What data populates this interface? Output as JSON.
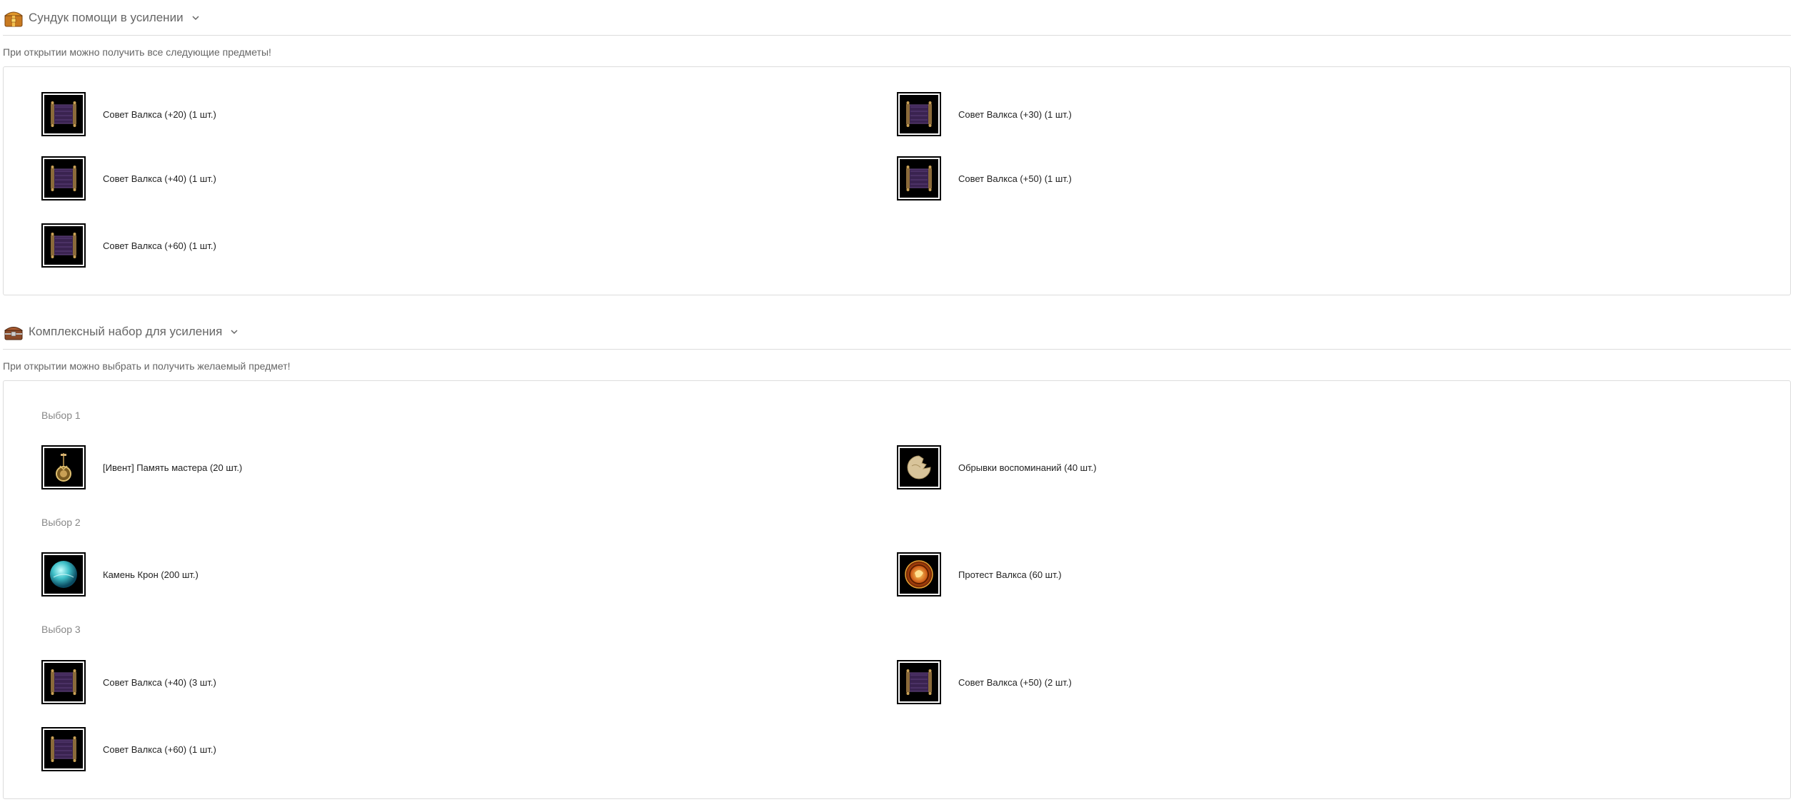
{
  "section1": {
    "title": "Сундук помощи в усилении",
    "description": "При открытии можно получить все следующие предметы!",
    "items": [
      {
        "label": "Совет Валкса (+20) (1 шт.)",
        "icon": "scroll-icon"
      },
      {
        "label": "Совет Валкса (+30) (1 шт.)",
        "icon": "scroll-icon"
      },
      {
        "label": "Совет Валкса (+40) (1 шт.)",
        "icon": "scroll-icon"
      },
      {
        "label": "Совет Валкса (+50) (1 шт.)",
        "icon": "scroll-icon"
      },
      {
        "label": "Совет Валкса (+60) (1 шт.)",
        "icon": "scroll-icon"
      }
    ]
  },
  "section2": {
    "title": "Комплексный набор для усиления",
    "description": "При открытии можно выбрать и получить желаемый предмет!",
    "choices": [
      {
        "label": "Выбор 1",
        "items": [
          {
            "label": "[Ивент] Память мастера (20 шт.)",
            "icon": "pendant-icon"
          },
          {
            "label": "Обрывки воспоминаний (40 шт.)",
            "icon": "fragment-icon"
          }
        ]
      },
      {
        "label": "Выбор 2",
        "items": [
          {
            "label": "Камень Крон (200 шт.)",
            "icon": "cron-stone-icon"
          },
          {
            "label": "Протест Валкса (60 шт.)",
            "icon": "valks-protest-icon"
          }
        ]
      },
      {
        "label": "Выбор 3",
        "items": [
          {
            "label": "Совет Валкса (+40) (3 шт.)",
            "icon": "scroll-icon"
          },
          {
            "label": "Совет Валкса (+50) (2 шт.)",
            "icon": "scroll-icon"
          },
          {
            "label": "Совет Валкса (+60) (1 шт.)",
            "icon": "scroll-icon"
          }
        ]
      }
    ]
  },
  "colors": {
    "border": "#dcdcdc",
    "muted_text": "#666666",
    "slot_bg": "#000000"
  }
}
